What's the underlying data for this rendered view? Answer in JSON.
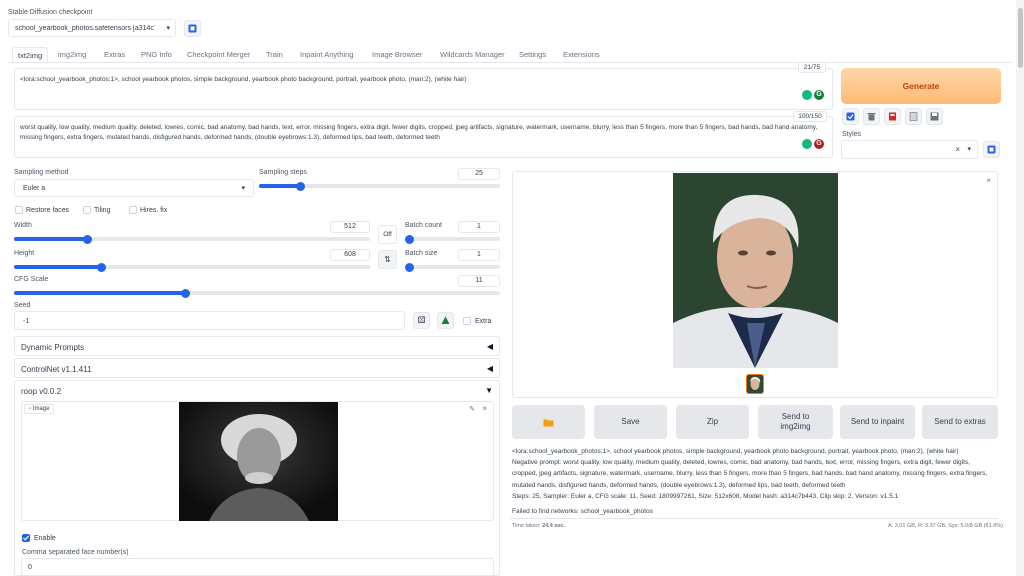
{
  "checkpoint": {
    "label": "Stable Diffusion checkpoint",
    "value": "school_yearbook_photos.safetensors [a314c7b4"
  },
  "tabs": [
    "txt2img",
    "img2img",
    "Extras",
    "PNG Info",
    "Checkpoint Merger",
    "Train",
    "Inpaint Anything",
    "Image Browser",
    "Wildcards Manager",
    "Settings",
    "Extensions"
  ],
  "prompt": {
    "text": "<lora:school_yearbook_photos:1>, school yearbook photos, simple background, yearbook photo background, portrait, yearbook photo, (man:2), (white hair)",
    "counter": "21/75"
  },
  "negative_prompt": {
    "text": "worst quality, low quality, medium quality, deleted, lowres, comic, bad anatomy, bad hands, text, error, missing fingers, extra digit, fewer digits, cropped, jpeg artifacts, signature, watermark, username, blurry, less than 5 fingers, more than 5 fingers, bad hands, bad hand anatomy, missing fingers, extra fingers, mutated hands, disfigured hands, deformed hands, (double eyebrows:1.3), deformed lips, bad teeth, deformed teeth",
    "counter": "100/150"
  },
  "generate_label": "Generate",
  "styles_label": "Styles",
  "sampling": {
    "method_label": "Sampling method",
    "method_value": "Euler a",
    "steps_label": "Sampling steps",
    "steps_value": "25",
    "steps_fraction": 0.16
  },
  "checkboxes": {
    "restore_faces": "Restore faces",
    "tiling": "Tiling",
    "hires_fix": "Hires. fix"
  },
  "width": {
    "label": "Width",
    "value": "512",
    "fraction": 0.2
  },
  "height": {
    "label": "Height",
    "value": "608",
    "fraction": 0.24
  },
  "batch_count": {
    "label": "Batch count",
    "value": "1",
    "fraction": 0
  },
  "batch_size": {
    "label": "Batch size",
    "value": "1",
    "fraction": 0
  },
  "off_label": "Off",
  "swap_label": "⇅",
  "cfg": {
    "label": "CFG Scale",
    "value": "11",
    "fraction": 0.35
  },
  "seed": {
    "label": "Seed",
    "value": "-1",
    "extra_label": "Extra"
  },
  "accordions": {
    "dynamic_prompts": "Dynamic Prompts",
    "controlnet": "ControlNet v1.1.411",
    "roop": "roop v0.0.2"
  },
  "image_label": "Image",
  "enable_label": "Enable",
  "face_numbers": {
    "label": "Comma separated face number(s)",
    "value": "0"
  },
  "actions": {
    "folder_icon": "folder-icon",
    "save": "Save",
    "zip": "Zip",
    "send_img2img": "Send to img2img",
    "send_inpaint": "Send to inpaint",
    "send_extras": "Send to extras"
  },
  "info": {
    "line1": "<lora:school_yearbook_photos:1>, school yearbook photos, simple background, yearbook photo background, portrait, yearbook photo, (man:2), (white hair)",
    "line2": "Negative prompt: worst quality, low quality, medium quality, deleted, lowres, comic, bad anatomy, bad hands, text, error, missing fingers, extra digit, fewer digits,",
    "line3": "cropped, jpeg artifacts, signature, watermark, username, blurry, less than 5 fingers, more than 5 fingers, bad hands, bad hand anatomy, missing fingers, extra fingers,",
    "line4": "mutated hands, disfigured hands, deformed hands, (double eyebrows:1.3), deformed lips, bad teeth, deformed teeth",
    "line5": "Steps: 25, Sampler: Euler a, CFG scale: 11, Seed: 1809997261, Size: 512x608, Model hash: a314c7b443, Clip skip: 2, Version: v1.5.1",
    "failed": "Failed to find networks: school_yearbook_photos",
    "time_prefix": "Time taken:",
    "time_value": "24.4 sec.",
    "mem": "A: 3.01 GB, R: 3.37 GB, Sys: 5.0/8 GB (61.9%)"
  },
  "colors": {
    "accent": "#2563eb",
    "generate_from": "#fed7aa",
    "generate_to": "#fdba74",
    "generate_text": "#c2410c"
  }
}
